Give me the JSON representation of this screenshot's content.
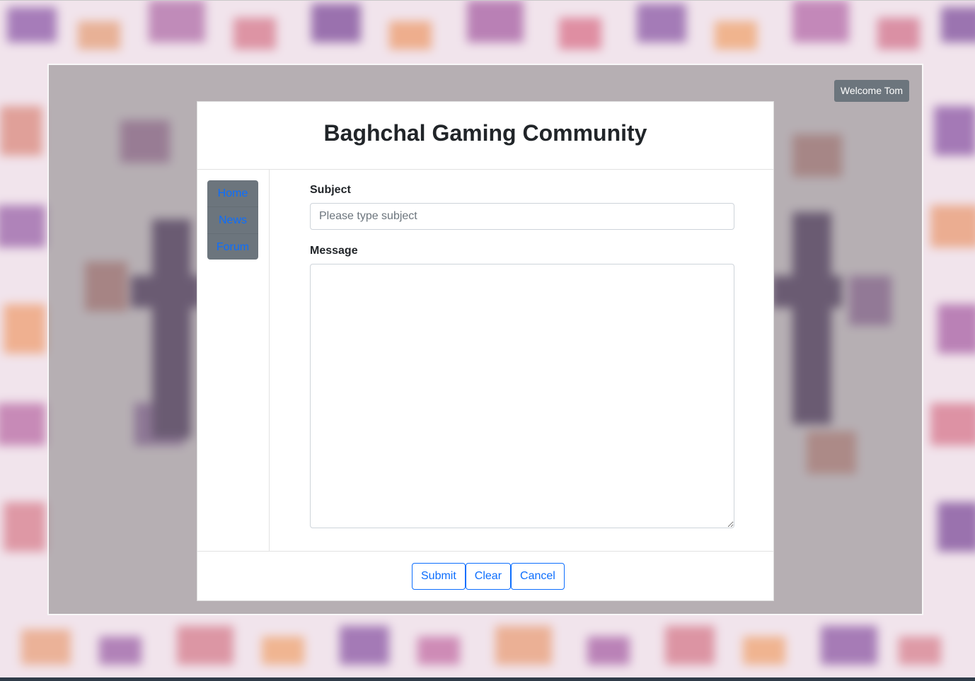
{
  "header": {
    "welcome": "Welcome Tom",
    "title": "Baghchal Gaming Community"
  },
  "sidebar": {
    "items": [
      {
        "label": "Home"
      },
      {
        "label": "News"
      },
      {
        "label": "Forum"
      }
    ]
  },
  "form": {
    "subject_label": "Subject",
    "subject_placeholder": "Please type subject",
    "subject_value": "",
    "message_label": "Message",
    "message_value": ""
  },
  "actions": {
    "submit": "Submit",
    "clear": "Clear",
    "cancel": "Cancel"
  },
  "colors": {
    "primary": "#0d6efd",
    "nav_bg": "#6c757d",
    "badge_bg": "#6c757d",
    "text": "#212529"
  }
}
